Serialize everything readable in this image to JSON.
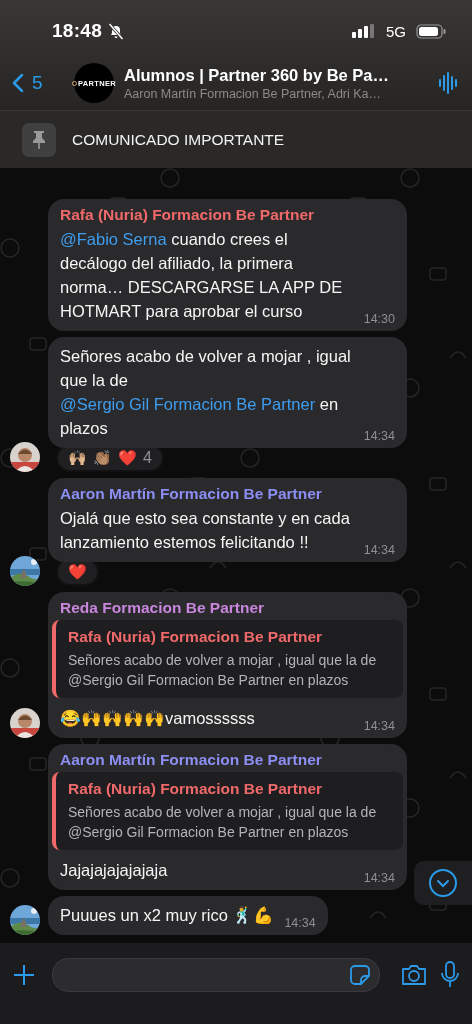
{
  "status_bar": {
    "time": "18:48",
    "muted": true,
    "network": "5G"
  },
  "header": {
    "back_count": "5",
    "group_logo_text": "PARTNER",
    "title": "Alumnos | Partner 360 by Be Pa…",
    "subtitle": "Aaron Martín Formacion Be Partner, Adri Ka…"
  },
  "pinned": {
    "text": "COMUNICADO IMPORTANTE"
  },
  "messages": [
    {
      "sender": "Rafa (Nuria) Formacion Be Partner",
      "color": "#f0696a",
      "body": [
        {
          "kind": "mention",
          "text": "@Fabio Serna"
        },
        {
          "kind": "text",
          "text": " cuando crees el decálogo del afiliado, la primera norma… DESCARGARSE LA APP DE HOTMART para aprobar el curso"
        }
      ],
      "time": "14:30"
    },
    {
      "avatar": {
        "kind": "picture"
      },
      "body": [
        {
          "kind": "text",
          "text": "Señores acabo de volver a mojar , igual que la de "
        },
        {
          "kind": "mention",
          "text": "@Sergio Gil Formacion Be Partner"
        },
        {
          "kind": "text",
          "text": " en plazos"
        }
      ],
      "time": "14:34",
      "reactions": [
        "🙌🏼",
        "👏🏽",
        "❤️"
      ],
      "reaction_count": "4"
    },
    {
      "sender": "Aaron Martín Formacion Be Partner",
      "color": "#8b8ef2",
      "avatar": {
        "kind": "picture"
      },
      "body": [
        {
          "kind": "text",
          "text": "Ojalá que esto sea constante y en cada lanzamiento estemos felicitando !!"
        }
      ],
      "time": "14:34",
      "reactions": [
        "❤️"
      ]
    },
    {
      "sender": "Reda Formacion Be Partner",
      "color": "#c886dc",
      "avatar": {
        "kind": "picture"
      },
      "quote": {
        "sender": "Rafa (Nuria) Formacion Be Partner",
        "color": "#f0696a",
        "text": "Señores acabo de volver a mojar , igual que la de @Sergio Gil Formacion Be Partner en plazos"
      },
      "body": [
        {
          "kind": "text",
          "text": "😂🙌🙌🙌🙌vamossssss"
        }
      ],
      "time": "14:34"
    },
    {
      "sender": "Aaron Martín Formacion Be Partner",
      "color": "#8b8ef2",
      "quote": {
        "sender": "Rafa (Nuria) Formacion Be Partner",
        "color": "#f0696a",
        "text": "Señores acabo de volver a mojar , igual que la de @Sergio Gil Formacion Be Partner en plazos"
      },
      "body": [
        {
          "kind": "text",
          "text": "Jajajajajajajaja"
        }
      ],
      "time": "14:34"
    },
    {
      "avatar": {
        "kind": "picture"
      },
      "body": [
        {
          "kind": "text",
          "text": "Puuues un x2 muy rico 🕺💪"
        }
      ],
      "time": "14:34"
    }
  ]
}
